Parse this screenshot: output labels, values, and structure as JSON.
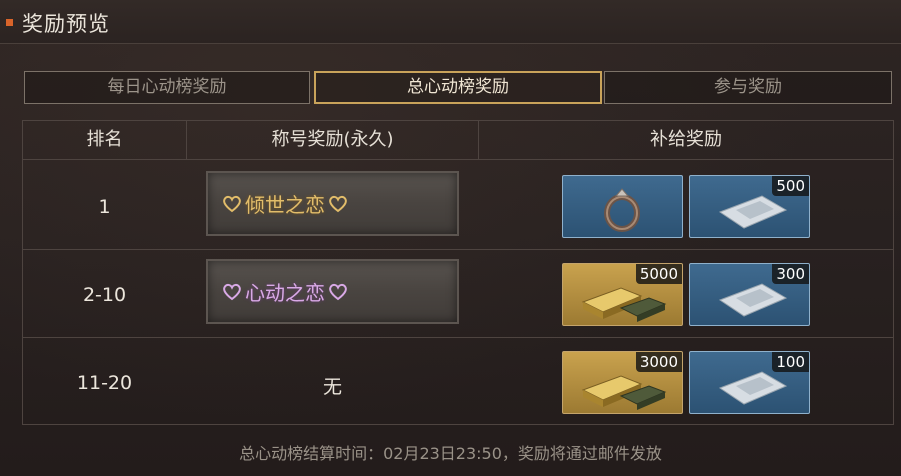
{
  "header": {
    "title": "奖励预览"
  },
  "tabs": [
    {
      "label": "每日心动榜奖励",
      "active": false
    },
    {
      "label": "总心动榜奖励",
      "active": true
    },
    {
      "label": "参与奖励",
      "active": false
    }
  ],
  "table": {
    "columns": [
      "排名",
      "称号奖励(永久)",
      "补给奖励"
    ],
    "rows": [
      {
        "rank": "1",
        "title": "倾世之恋",
        "title_color": "#e2bd6a",
        "rewards": [
          {
            "icon": "ring-icon",
            "count": ""
          },
          {
            "icon": "silver-ticket-icon",
            "count": "500"
          }
        ]
      },
      {
        "rank": "2-10",
        "title": "心动之恋",
        "title_color": "#d9a9e6",
        "rewards": [
          {
            "icon": "gold-bars-icon",
            "count": "5000"
          },
          {
            "icon": "silver-ticket-icon",
            "count": "300"
          }
        ]
      },
      {
        "rank": "11-20",
        "title": "无",
        "rewards": [
          {
            "icon": "gold-bars-icon",
            "count": "3000"
          },
          {
            "icon": "silver-ticket-icon",
            "count": "100"
          }
        ]
      }
    ]
  },
  "footer": {
    "text": "总心动榜结算时间：02月23日23:50，奖励将通过邮件发放"
  },
  "colors": {
    "accent": "#d9642a",
    "active_tab_border": "#c9a35a",
    "item_blue": "#3a6488",
    "item_gold": "#b8923f"
  }
}
